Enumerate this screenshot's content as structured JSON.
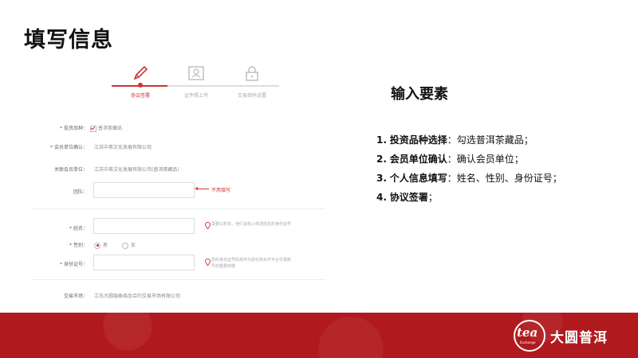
{
  "title": "填写信息",
  "steps": [
    {
      "label": "协议签署",
      "icon": "pencil-icon"
    },
    {
      "label": "证件照上传",
      "icon": "id-card-icon"
    },
    {
      "label": "交易密码设置",
      "icon": "lock-icon"
    }
  ],
  "form": {
    "variety": {
      "label": "投资品种：",
      "option": "普洱茶藏品"
    },
    "member_unit": {
      "label": "会员单位确认：",
      "value": "江苏中茶文化发展有限公司"
    },
    "related_unit": {
      "label": "关联会员单位：",
      "value": "江苏中茶文化发展有限公司(普洱茶藏品)"
    },
    "team": {
      "label": "团队：",
      "note": "不用填写"
    },
    "name": {
      "label": "姓名：",
      "hint": "需要以购买，他们会购入候选姓名的身份证号"
    },
    "gender": {
      "label": "性别：",
      "options": [
        "男",
        "女"
      ]
    },
    "id_number": {
      "label": "身份证号：",
      "hint": "您的身份证号码将作为您在购买开平台交易账号的重要依据"
    },
    "market": {
      "label": "交易市场：",
      "value": "江苏大圆银泰商品合约交易市场有限公司"
    }
  },
  "requirements": {
    "title": "输入要素",
    "items": [
      {
        "num": "1.",
        "key": "投资品种选择",
        "sep": "：",
        "desc": "勾选普洱茶藏品；"
      },
      {
        "num": "2.",
        "key": "会员单位确认",
        "sep": "：",
        "desc": "确认会员单位；"
      },
      {
        "num": "3.",
        "key": "个人信息填写",
        "sep": "：",
        "desc": "姓名、性别、身份证号；"
      },
      {
        "num": "4.",
        "key": "协议签署",
        "sep": "；",
        "desc": ""
      }
    ]
  },
  "footer": {
    "logo_main": "tea",
    "logo_sub": "Exchange",
    "brand": "大圆普洱"
  },
  "colors": {
    "accent": "#cc3333",
    "footer": "#b01a1e"
  }
}
